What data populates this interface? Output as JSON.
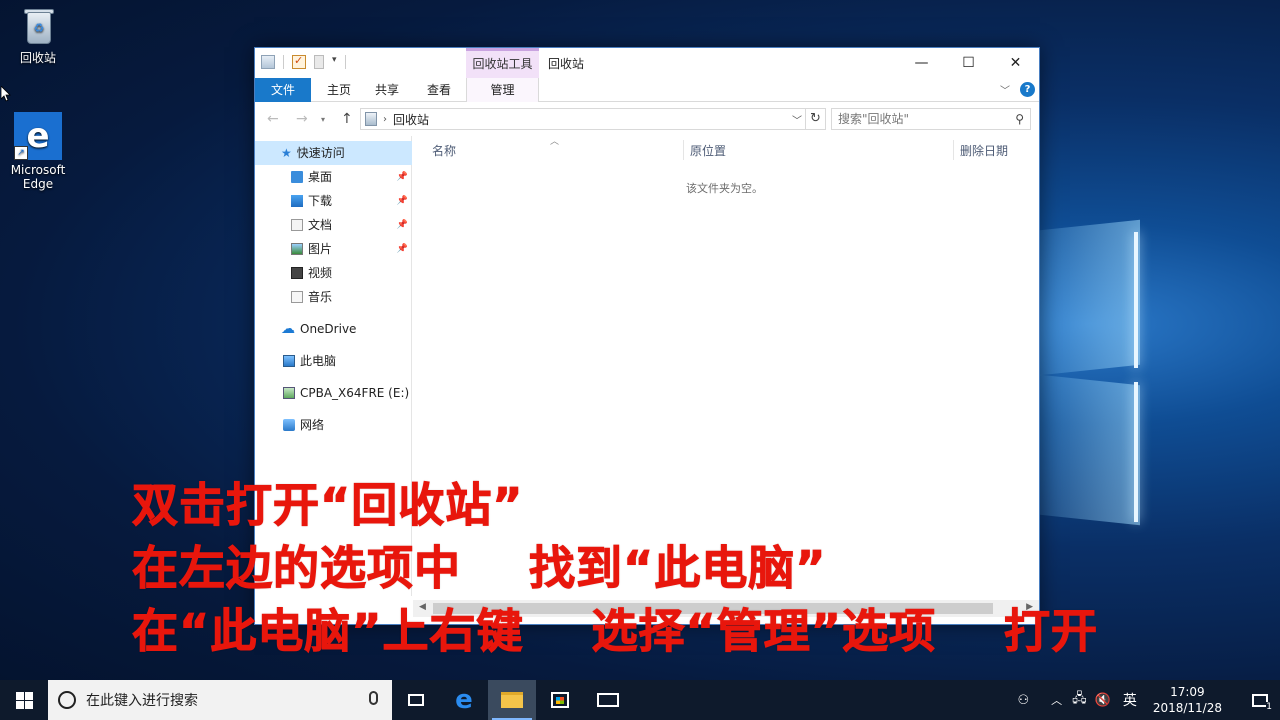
{
  "desktop": {
    "icons": [
      {
        "label": "回收站",
        "icon": "recycle-bin-icon"
      },
      {
        "label": "Microsoft Edge",
        "icon": "edge-icon"
      }
    ]
  },
  "window": {
    "title": "回收站",
    "context_tab_group": "回收站工具",
    "ribbon_tabs": [
      "文件",
      "主页",
      "共享",
      "查看",
      "管理"
    ],
    "active_tab": "文件",
    "address": {
      "path": "回收站",
      "search_placeholder": "搜索\"回收站\""
    },
    "nav_pane": {
      "quick_access": "快速访问",
      "pinned": [
        "桌面",
        "下载",
        "文档",
        "图片"
      ],
      "unpinned": [
        "视频",
        "音乐"
      ],
      "onedrive": "OneDrive",
      "this_pc": "此电脑",
      "drive": "CPBA_X64FRE (E:)",
      "network": "网络"
    },
    "columns": [
      "名称",
      "原位置",
      "删除日期"
    ],
    "empty_message": "该文件夹为空。"
  },
  "caption": {
    "line1": "双击打开“回收站”",
    "line2": "在左边的选项中    找到“此电脑”",
    "line3": "在“此电脑”上右键    选择“管理”选项    打开"
  },
  "taskbar": {
    "search_placeholder": "在此键入进行搜索",
    "input_language": "英",
    "time": "17:09",
    "date": "2018/11/28",
    "notification_count": "1"
  },
  "colors": {
    "accent": "#1979ca",
    "caption": "#e8160c",
    "context_tab": "#f2e1f8",
    "taskbar": "#0e1a2c"
  }
}
